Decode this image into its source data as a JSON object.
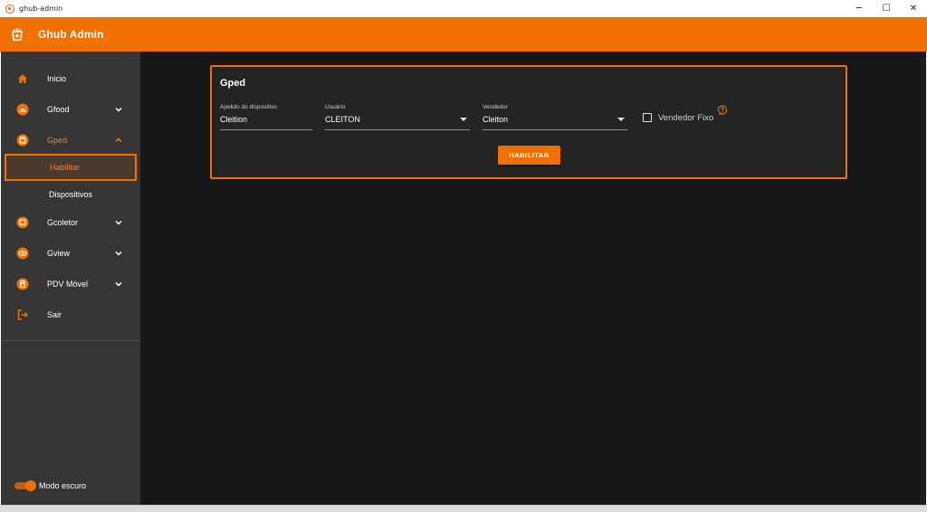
{
  "window": {
    "title": "ghub-admin",
    "minimize": "─",
    "maximize": "☐",
    "close": "✕"
  },
  "app": {
    "title": "Ghub Admin",
    "accent": "#f07000"
  },
  "sidebar": {
    "items": [
      {
        "label": "Inicio",
        "icon": "home-icon"
      },
      {
        "label": "Gfood",
        "icon": "gfood-icon",
        "chevron": "chevron-down-icon"
      },
      {
        "label": "Gped",
        "icon": "gped-icon",
        "chevron": "chevron-up-icon",
        "active": true
      },
      {
        "label": "Gcoletor",
        "icon": "gcoletor-icon",
        "chevron": "chevron-down-icon"
      },
      {
        "label": "Gview",
        "icon": "gview-icon",
        "chevron": "chevron-down-icon"
      },
      {
        "label": "PDV Móvel",
        "icon": "pdv-icon",
        "chevron": "chevron-down-icon"
      },
      {
        "label": "Sair",
        "icon": "logout-icon"
      }
    ],
    "subitems": [
      {
        "label": "Habilitar",
        "active": true
      },
      {
        "label": "Dispositivos"
      }
    ],
    "dark_mode": {
      "label": "Modo escuro",
      "on": true
    }
  },
  "card": {
    "title": "Gped",
    "fields": {
      "apelido": {
        "label": "Apelido do dispositivo",
        "value": "Cleition"
      },
      "usuario": {
        "label": "Usuário",
        "value": "CLEITON"
      },
      "vendedor": {
        "label": "Vendedor",
        "value": "Cleiton"
      }
    },
    "vendedor_fixo": {
      "label": "Vendedor Fixo",
      "checked": false
    },
    "button": "HABILITAR"
  }
}
